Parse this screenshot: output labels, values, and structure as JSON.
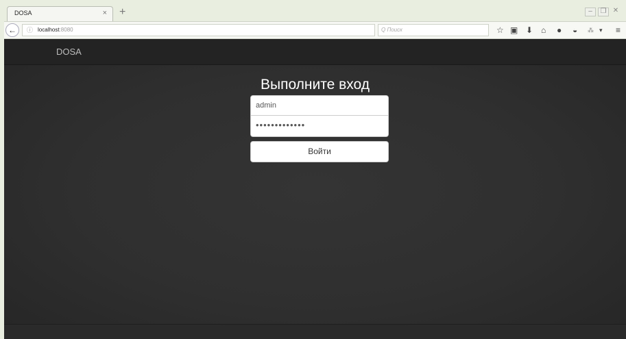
{
  "browser": {
    "tab_title": "DOSA",
    "tab_close": "×",
    "new_tab": "+",
    "back": "←",
    "info_icon": "ⓘ",
    "url_host": "localhost",
    "url_port": ":8080",
    "reload": "C",
    "search_placeholder": "Q Поиск",
    "toolbar_icons": [
      "star-icon",
      "bookmarks-icon",
      "download-icon",
      "home-icon",
      "chat-icon",
      "pocket-icon",
      "extension-icon",
      "menu-icon"
    ],
    "window_controls": [
      "minimize",
      "restore",
      "close"
    ]
  },
  "site": {
    "brand": "DOSA",
    "heading": "Выполните вход",
    "username_value": "admin",
    "password_value": "•••••••••••••",
    "submit_label": "Войти"
  },
  "colors": {
    "page_bg": "#2f2f2f",
    "navbar_bg": "#232323",
    "heading_text": "#ffffff",
    "brand_text": "#bdbdbd"
  }
}
